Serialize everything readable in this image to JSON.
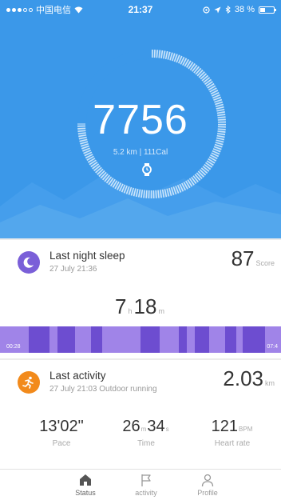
{
  "status_bar": {
    "carrier": "中国电信",
    "time": "21:37",
    "battery": "38 %"
  },
  "hero": {
    "steps": "7756",
    "summary": "5.2 km | 111Cal"
  },
  "sleep": {
    "title": "Last night sleep",
    "date": "27 July 21:36",
    "score": "87",
    "score_unit": "Score",
    "hours": "7",
    "hours_unit": "h",
    "minutes": "18",
    "minutes_unit": "m",
    "start_time": "00:28",
    "end_time": "07:4"
  },
  "activity": {
    "title": "Last activity",
    "subtitle": "27 July 21:03 Outdoor running",
    "distance": "2.03",
    "distance_unit": "km",
    "pace_value": "13'02\"",
    "pace_label": "Pace",
    "time_min": "26",
    "time_min_unit": "m",
    "time_sec": "34",
    "time_sec_unit": "s",
    "time_label": "Time",
    "heart_value": "121",
    "heart_unit": "BPM",
    "heart_label": "Heart rate"
  },
  "tabs": [
    {
      "label": "Status",
      "icon": "home-icon"
    },
    {
      "label": "activity",
      "icon": "flag-icon"
    },
    {
      "label": "Profile",
      "icon": "person-icon"
    }
  ],
  "colors": {
    "hero_blue": "#3b98e9",
    "sleep_purple": "#7a5fd8",
    "activity_orange": "#f28a1b"
  }
}
